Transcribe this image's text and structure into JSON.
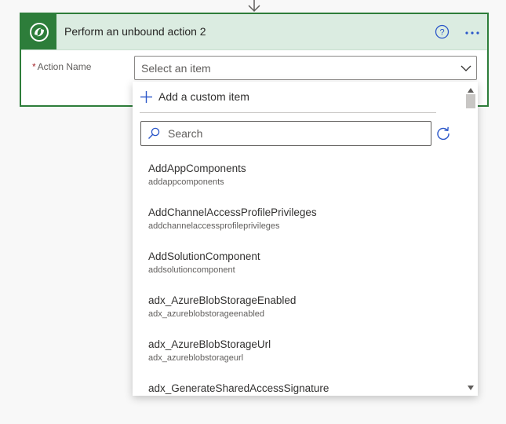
{
  "card": {
    "title": "Perform an unbound action 2",
    "app_icon": "dataverse-icon",
    "accent_color": "#2d7d3a",
    "header_bg": "#dbece1"
  },
  "field": {
    "required_marker": "*",
    "label": "Action Name",
    "placeholder": "Select an item"
  },
  "dropdown": {
    "custom_item_label": "Add a custom item",
    "search_placeholder": "Search",
    "items": [
      {
        "title": "AddAppComponents",
        "subtitle": "addappcomponents"
      },
      {
        "title": "AddChannelAccessProfilePrivileges",
        "subtitle": "addchannelaccessprofileprivileges"
      },
      {
        "title": "AddSolutionComponent",
        "subtitle": "addsolutioncomponent"
      },
      {
        "title": "adx_AzureBlobStorageEnabled",
        "subtitle": "adx_azureblobstorageenabled"
      },
      {
        "title": "adx_AzureBlobStorageUrl",
        "subtitle": "adx_azureblobstorageurl"
      },
      {
        "title": "adx_GenerateSharedAccessSignature",
        "subtitle": ""
      }
    ]
  }
}
